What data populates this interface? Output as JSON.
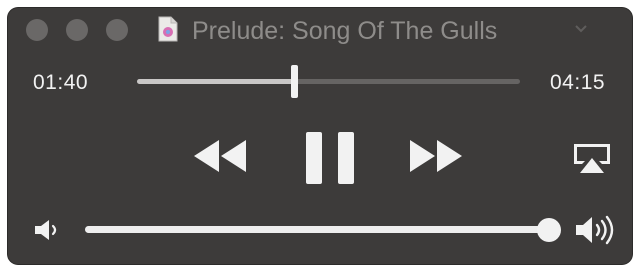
{
  "window": {
    "title": "Prelude: Song Of The Gulls",
    "title_color": "#8e8c8a",
    "background": "#3d3b3a",
    "document_icon": "music-file-icon"
  },
  "traffic_lights": [
    "close",
    "minimize",
    "zoom"
  ],
  "playback": {
    "elapsed": "01:40",
    "duration": "04:15",
    "progress_fraction": 0.41
  },
  "controls": {
    "rewind_icon": "rewind-icon",
    "pause_icon": "pause-icon",
    "forward_icon": "fast-forward-icon",
    "airplay_icon": "airplay-icon"
  },
  "volume": {
    "level_fraction": 1.0,
    "low_icon": "speaker-low-icon",
    "high_icon": "speaker-high-icon"
  }
}
